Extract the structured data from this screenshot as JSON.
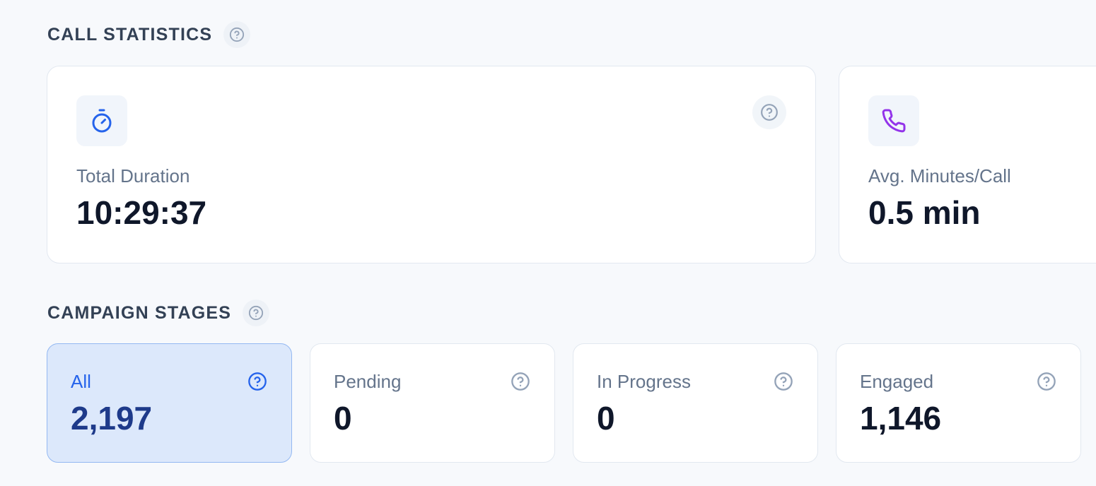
{
  "call_statistics": {
    "title": "CALL STATISTICS",
    "help_icon": "question-circle-icon",
    "cards": [
      {
        "label": "Total Duration",
        "value": "10:29:37",
        "icon": "stopwatch-icon",
        "icon_color": "#2563eb",
        "help_icon": "question-circle-icon"
      },
      {
        "label": "Avg. Minutes/Call",
        "value": "0.5 min",
        "icon": "phone-icon",
        "icon_color": "#9333ea"
      }
    ]
  },
  "campaign_stages": {
    "title": "CAMPAIGN STAGES",
    "help_icon": "question-circle-icon",
    "selected": "All",
    "stages": [
      {
        "label": "All",
        "value": "2,197",
        "help_icon": "question-circle-icon"
      },
      {
        "label": "Pending",
        "value": "0",
        "help_icon": "question-circle-icon"
      },
      {
        "label": "In Progress",
        "value": "0",
        "help_icon": "question-circle-icon"
      },
      {
        "label": "Engaged",
        "value": "1,146",
        "help_icon": "question-circle-icon"
      }
    ]
  },
  "colors": {
    "background": "#f7f9fc",
    "accent": "#2563eb",
    "active_card_bg": "#dce8fb",
    "active_card_border": "#93b8f2",
    "text_primary": "#0f172a",
    "text_muted": "#64748b"
  }
}
